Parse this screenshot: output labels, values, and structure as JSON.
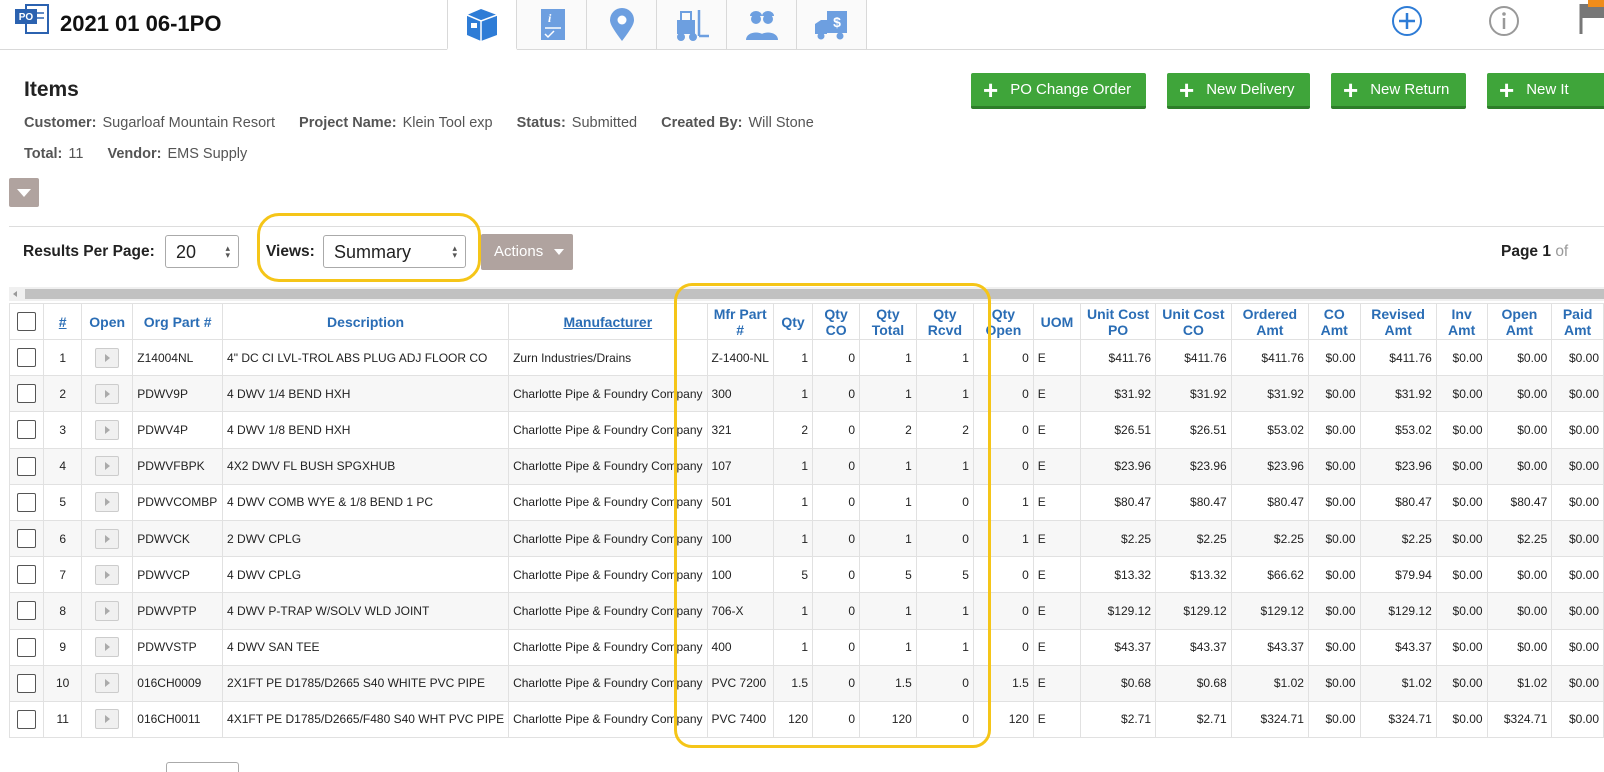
{
  "header": {
    "po_badge": "PO",
    "title": "2021 01 06-1PO",
    "tabs": [
      {
        "name": "items-tab",
        "icon": "box-icon",
        "active": true
      },
      {
        "name": "info-tab",
        "icon": "document-info-icon",
        "active": false
      },
      {
        "name": "location-tab",
        "icon": "map-pin-icon",
        "active": false
      },
      {
        "name": "delivery-tab",
        "icon": "forklift-icon",
        "active": false
      },
      {
        "name": "contacts-tab",
        "icon": "workers-icon",
        "active": false
      },
      {
        "name": "billing-tab",
        "icon": "truck-dollar-icon",
        "active": false
      }
    ],
    "right_icons": [
      "add-circle-icon",
      "info-circle-icon",
      "flag-icon"
    ]
  },
  "section": {
    "title": "Items",
    "meta": {
      "customer_label": "Customer:",
      "customer": "Sugarloaf Mountain Resort",
      "project_label": "Project Name:",
      "project": "Klein Tool exp",
      "status_label": "Status:",
      "status": "Submitted",
      "created_label": "Created By:",
      "created_by": "Will Stone",
      "total_label": "Total:",
      "total": "11",
      "vendor_label": "Vendor:",
      "vendor": "EMS Supply"
    },
    "buttons": {
      "po_change_order": "PO Change Order",
      "new_delivery": "New Delivery",
      "new_return": "New Return",
      "new_item": "New It"
    }
  },
  "toolbar": {
    "results_label": "Results Per Page:",
    "results_value": "20",
    "views_label": "Views:",
    "views_value": "Summary",
    "actions_label": "Actions",
    "page_prefix": "Page",
    "page_number": "1",
    "page_suffix": "of"
  },
  "colors": {
    "green": "#3fa53a",
    "header_blue": "#2a6db5",
    "highlight": "#f5c518",
    "taupe": "#b0a39f"
  },
  "grid": {
    "columns": [
      "#",
      "Open",
      "Org Part #",
      "Description",
      "Manufacturer",
      "Mfr Part #",
      "Qty",
      "Qty CO",
      "Qty Total",
      "Qty Rcvd",
      "Qty Open",
      "UOM",
      "Unit Cost PO",
      "Unit Cost CO",
      "Ordered Amt",
      "CO Amt",
      "Revised Amt",
      "Inv Amt",
      "Open Amt",
      "Paid Amt"
    ],
    "rows": [
      [
        "1",
        "Z14004NL",
        "4\" DC CI LVL-TROL ABS PLUG ADJ FLOOR CO",
        "Zurn Industries/Drains",
        "Z-1400-NL",
        "1",
        "0",
        "1",
        "1",
        "0",
        "E",
        "$411.76",
        "$411.76",
        "$411.76",
        "$0.00",
        "$411.76",
        "$0.00",
        "$0.00",
        "$0.00"
      ],
      [
        "2",
        "PDWV9P",
        "4 DWV 1/4 BEND HXH",
        "Charlotte Pipe & Foundry Company",
        "300",
        "1",
        "0",
        "1",
        "1",
        "0",
        "E",
        "$31.92",
        "$31.92",
        "$31.92",
        "$0.00",
        "$31.92",
        "$0.00",
        "$0.00",
        "$0.00"
      ],
      [
        "3",
        "PDWV4P",
        "4 DWV 1/8 BEND HXH",
        "Charlotte Pipe & Foundry Company",
        "321",
        "2",
        "0",
        "2",
        "2",
        "0",
        "E",
        "$26.51",
        "$26.51",
        "$53.02",
        "$0.00",
        "$53.02",
        "$0.00",
        "$0.00",
        "$0.00"
      ],
      [
        "4",
        "PDWVFBPK",
        "4X2 DWV FL BUSH SPGXHUB",
        "Charlotte Pipe & Foundry Company",
        "107",
        "1",
        "0",
        "1",
        "1",
        "0",
        "E",
        "$23.96",
        "$23.96",
        "$23.96",
        "$0.00",
        "$23.96",
        "$0.00",
        "$0.00",
        "$0.00"
      ],
      [
        "5",
        "PDWVCOMBP",
        "4 DWV COMB WYE & 1/8 BEND 1 PC",
        "Charlotte Pipe & Foundry Company",
        "501",
        "1",
        "0",
        "1",
        "0",
        "1",
        "E",
        "$80.47",
        "$80.47",
        "$80.47",
        "$0.00",
        "$80.47",
        "$0.00",
        "$80.47",
        "$0.00"
      ],
      [
        "6",
        "PDWVCK",
        "2 DWV CPLG",
        "Charlotte Pipe & Foundry Company",
        "100",
        "1",
        "0",
        "1",
        "0",
        "1",
        "E",
        "$2.25",
        "$2.25",
        "$2.25",
        "$0.00",
        "$2.25",
        "$0.00",
        "$2.25",
        "$0.00"
      ],
      [
        "7",
        "PDWVCP",
        "4 DWV CPLG",
        "Charlotte Pipe & Foundry Company",
        "100",
        "5",
        "0",
        "5",
        "5",
        "0",
        "E",
        "$13.32",
        "$13.32",
        "$66.62",
        "$0.00",
        "$79.94",
        "$0.00",
        "$0.00",
        "$0.00"
      ],
      [
        "8",
        "PDWVPTP",
        "4 DWV P-TRAP W/SOLV WLD JOINT",
        "Charlotte Pipe & Foundry Company",
        "706-X",
        "1",
        "0",
        "1",
        "1",
        "0",
        "E",
        "$129.12",
        "$129.12",
        "$129.12",
        "$0.00",
        "$129.12",
        "$0.00",
        "$0.00",
        "$0.00"
      ],
      [
        "9",
        "PDWVSTP",
        "4 DWV SAN TEE",
        "Charlotte Pipe & Foundry Company",
        "400",
        "1",
        "0",
        "1",
        "1",
        "0",
        "E",
        "$43.37",
        "$43.37",
        "$43.37",
        "$0.00",
        "$43.37",
        "$0.00",
        "$0.00",
        "$0.00"
      ],
      [
        "10",
        "016CH0009",
        "2X1FT PE D1785/D2665 S40 WHITE PVC PIPE",
        "Charlotte Pipe & Foundry Company",
        "PVC 7200",
        "1.5",
        "0",
        "1.5",
        "0",
        "1.5",
        "E",
        "$0.68",
        "$0.68",
        "$1.02",
        "$0.00",
        "$1.02",
        "$0.00",
        "$1.02",
        "$0.00"
      ],
      [
        "11",
        "016CH0011",
        "4X1FT PE D1785/D2665/F480 S40 WHT PVC PIPE",
        "Charlotte Pipe & Foundry Company",
        "PVC 7400",
        "120",
        "0",
        "120",
        "0",
        "120",
        "E",
        "$2.71",
        "$2.71",
        "$324.71",
        "$0.00",
        "$324.71",
        "$0.00",
        "$324.71",
        "$0.00"
      ]
    ]
  }
}
